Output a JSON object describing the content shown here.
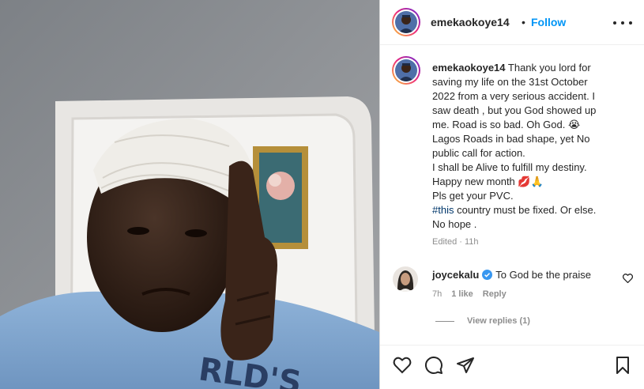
{
  "header": {
    "username": "emekaokoye14",
    "separator": "•",
    "follow_label": "Follow",
    "more_icon": "more-horizontal-icon"
  },
  "caption": {
    "username": "emekaokoye14",
    "lines": [
      "Thank you lord for",
      "saving my life on the 31st October",
      "2022 from a very serious accident. I",
      "saw death , but you God showed up",
      "me. Road is so bad. Oh God. 😭",
      "Lagos Roads in bad shape, yet No",
      "public call for action.",
      "I shall be Alive to fulfill my destiny.",
      "Happy new month 💋🙏",
      "Pls get your PVC.",
      "country must be fixed. Or else.",
      "No hope ."
    ],
    "hashtag": "#this",
    "edited": "Edited · 11h"
  },
  "comment": {
    "username": "joycekalu",
    "text": "To God be the praise",
    "time": "7h",
    "likes": "1 like",
    "reply_label": "Reply",
    "view_replies": "View replies (1)"
  },
  "actions": {
    "like_icon": "heart-icon",
    "comment_icon": "comment-icon",
    "share_icon": "share-icon",
    "save_icon": "bookmark-icon"
  },
  "colors": {
    "follow_blue": "#0095f6",
    "hashtag": "#00376b",
    "muted": "#8e8e8e",
    "verified": "#3897f0"
  }
}
